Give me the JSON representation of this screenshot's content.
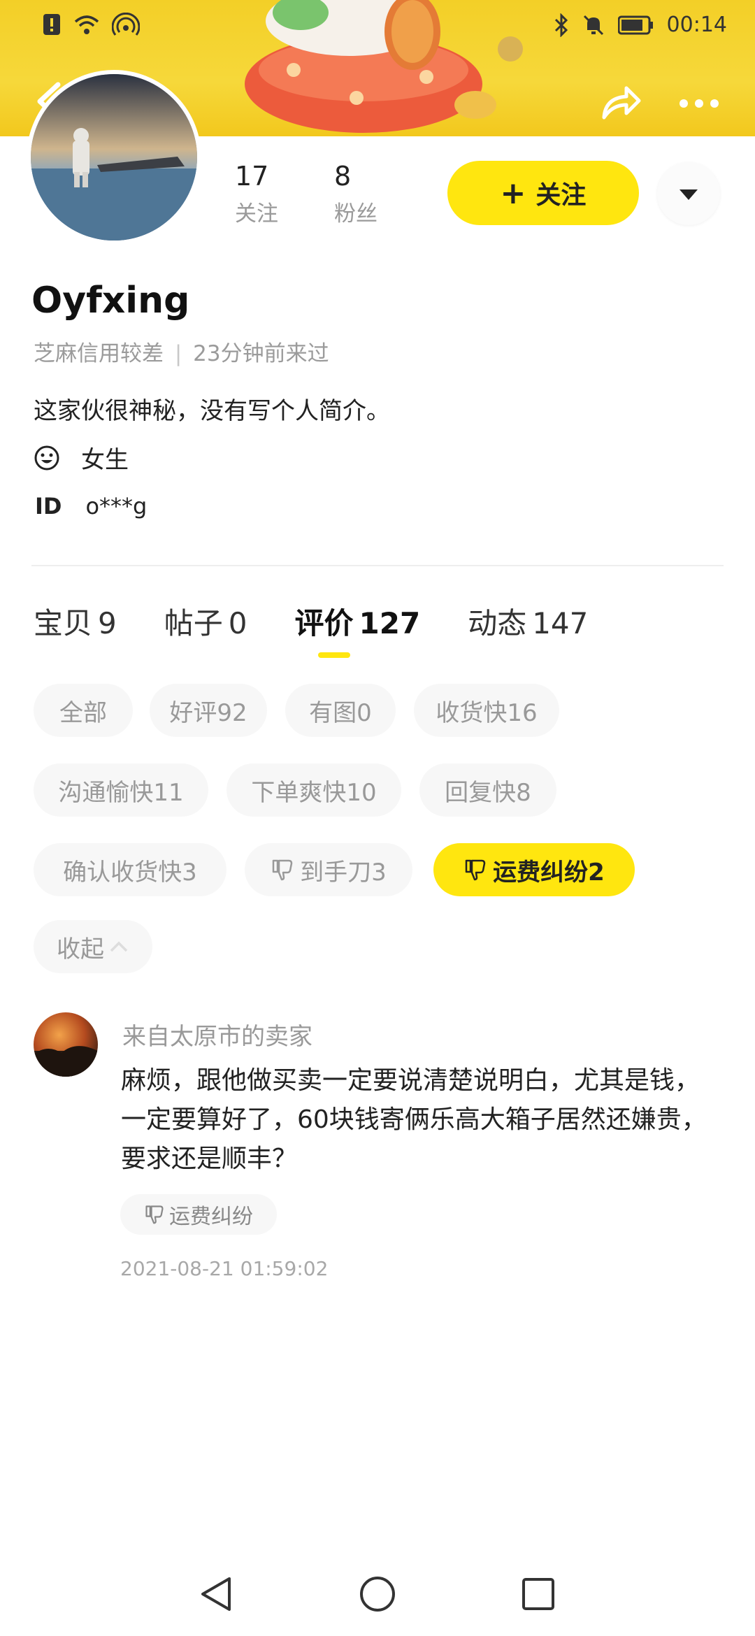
{
  "status_bar": {
    "time": "00:14",
    "battery": "84"
  },
  "profile": {
    "following_count": "17",
    "following_label": "关注",
    "followers_count": "8",
    "followers_label": "粉丝",
    "follow_button": "关注",
    "username": "Oyfxing",
    "credit": "芝麻信用较差",
    "last_seen": "23分钟前来过",
    "bio": "这家伙很神秘，没有写个人简介。",
    "gender": "女生",
    "id_label": "ID",
    "id_value": "o***g"
  },
  "tabs": [
    {
      "label": "宝贝",
      "count": "9"
    },
    {
      "label": "帖子",
      "count": "0"
    },
    {
      "label": "评价",
      "count": "127"
    },
    {
      "label": "动态",
      "count": "147"
    }
  ],
  "filters": [
    {
      "label": "全部"
    },
    {
      "label": "好评92"
    },
    {
      "label": "有图0"
    },
    {
      "label": "收货快16"
    },
    {
      "label": "沟通愉快11"
    },
    {
      "label": "下单爽快10"
    },
    {
      "label": "回复快8"
    },
    {
      "label": "确认收货快3"
    },
    {
      "label": "到手刀3"
    },
    {
      "label": "运费纠纷2"
    },
    {
      "label": "收起"
    }
  ],
  "review": {
    "from": "来自太原市的卖家",
    "text": "麻烦，跟他做买卖一定要说清楚说明白，尤其是钱，一定要算好了，60块钱寄俩乐高大箱子居然还嫌贵，要求还是顺丰？",
    "tag": "运费纠纷",
    "date": "2021-08-21 01:59:02"
  },
  "colors": {
    "brand_yellow": "#ffe60f",
    "chip_bg": "#f7f7f7",
    "muted_text": "#999999"
  },
  "icons": [
    "back-icon",
    "share-icon",
    "more-icon",
    "dropdown-icon",
    "smiley-icon",
    "thumbs-down-icon",
    "chevron-up-icon",
    "nav-back-icon",
    "nav-home-icon",
    "nav-recents-icon"
  ]
}
